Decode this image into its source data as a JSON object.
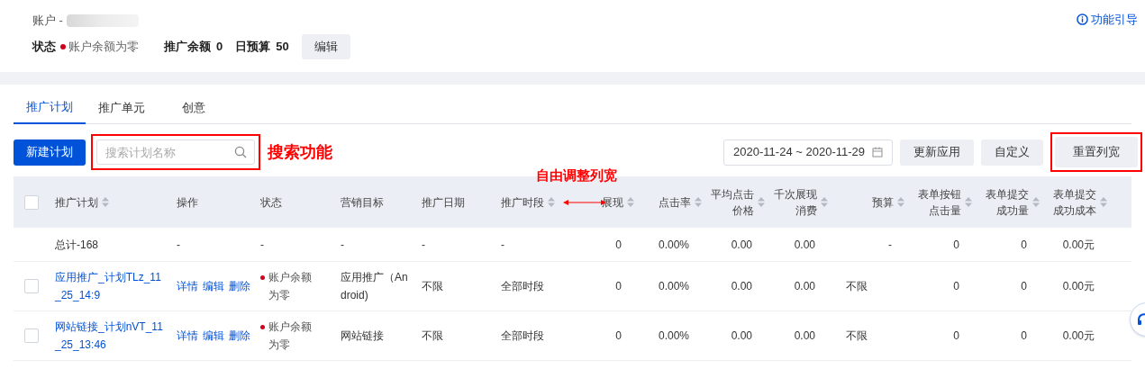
{
  "account": {
    "label": "账户 -"
  },
  "guide_link": "功能引导",
  "status": {
    "label": "状态",
    "value": "账户余额为零",
    "color": "#d0021b"
  },
  "metrics": [
    {
      "label": "推广余额",
      "value": "0"
    },
    {
      "label": "日预算",
      "value": "50"
    }
  ],
  "edit_button": "编辑",
  "tabs": [
    {
      "label": "推广计划",
      "selected": true
    },
    {
      "label": "推广单元",
      "selected": false
    },
    {
      "label": "创意",
      "selected": false
    }
  ],
  "toolbar": {
    "new_button": "新建计划",
    "search": {
      "placeholder": "搜索计划名称"
    },
    "date_range": "2020-11-24 ~ 2020-11-29",
    "buttons": [
      "更新应用",
      "自定义",
      "重置列宽"
    ]
  },
  "annotations": {
    "search_label": "搜索功能",
    "resize_label": "自由调整列宽"
  },
  "table": {
    "header_checked": false,
    "columns": [
      {
        "lines": [
          "推广计划"
        ],
        "sortable": true
      },
      {
        "lines": [
          "操作"
        ],
        "sortable": false
      },
      {
        "lines": [
          "状态"
        ],
        "sortable": false
      },
      {
        "lines": [
          "营销目标"
        ],
        "sortable": false
      },
      {
        "lines": [
          "推广日期"
        ],
        "sortable": false
      },
      {
        "lines": [
          "推广时段"
        ],
        "sortable": true
      },
      {
        "lines": [
          "展现"
        ],
        "sortable": true
      },
      {
        "lines": [
          "点击率"
        ],
        "sortable": true
      },
      {
        "lines": [
          "平均点击",
          "价格"
        ],
        "sortable": true
      },
      {
        "lines": [
          "千次展现",
          "消费"
        ],
        "sortable": true
      },
      {
        "lines": [
          "预算"
        ],
        "sortable": true
      },
      {
        "lines": [
          "表单按钮",
          "点击量"
        ],
        "sortable": true
      },
      {
        "lines": [
          "表单提交",
          "成功量"
        ],
        "sortable": true
      },
      {
        "lines": [
          "表单提交",
          "成功成本"
        ],
        "sortable": true
      }
    ],
    "total_row": [
      "总计-168",
      "-",
      "-",
      "-",
      "-",
      "-",
      "0",
      "0.00%",
      "0.00",
      "0.00",
      "-",
      "0",
      "0",
      "0.00元"
    ],
    "rows": [
      {
        "checked": false,
        "cells": [
          {
            "kind": "link",
            "text": "应用推广_计划TLz_11_25_14:9"
          },
          {
            "kind": "actions",
            "items": [
              "详情",
              "编辑",
              "删除"
            ]
          },
          {
            "kind": "status",
            "text": "账户余额为零",
            "color": "#d0021b"
          },
          {
            "kind": "text",
            "text": "应用推广（Android)"
          },
          {
            "kind": "text",
            "text": "不限"
          },
          {
            "kind": "text",
            "text": "全部时段"
          },
          {
            "kind": "text",
            "text": "0"
          },
          {
            "kind": "text",
            "text": "0.00%"
          },
          {
            "kind": "text",
            "text": "0.00"
          },
          {
            "kind": "text",
            "text": "0.00"
          },
          {
            "kind": "text",
            "text": "不限"
          },
          {
            "kind": "text",
            "text": "0"
          },
          {
            "kind": "text",
            "text": "0"
          },
          {
            "kind": "text",
            "text": "0.00元"
          }
        ]
      },
      {
        "checked": false,
        "cells": [
          {
            "kind": "link",
            "text": "网站链接_计划nVT_11_25_13:46"
          },
          {
            "kind": "actions",
            "items": [
              "详情",
              "编辑",
              "删除"
            ]
          },
          {
            "kind": "status",
            "text": "账户余额为零",
            "color": "#d0021b"
          },
          {
            "kind": "text",
            "text": "网站链接"
          },
          {
            "kind": "text",
            "text": "不限"
          },
          {
            "kind": "text",
            "text": "全部时段"
          },
          {
            "kind": "text",
            "text": "0"
          },
          {
            "kind": "text",
            "text": "0.00%"
          },
          {
            "kind": "text",
            "text": "0.00"
          },
          {
            "kind": "text",
            "text": "0.00"
          },
          {
            "kind": "text",
            "text": "不限"
          },
          {
            "kind": "text",
            "text": "0"
          },
          {
            "kind": "text",
            "text": "0"
          },
          {
            "kind": "text",
            "text": "0.00元"
          }
        ]
      }
    ]
  }
}
